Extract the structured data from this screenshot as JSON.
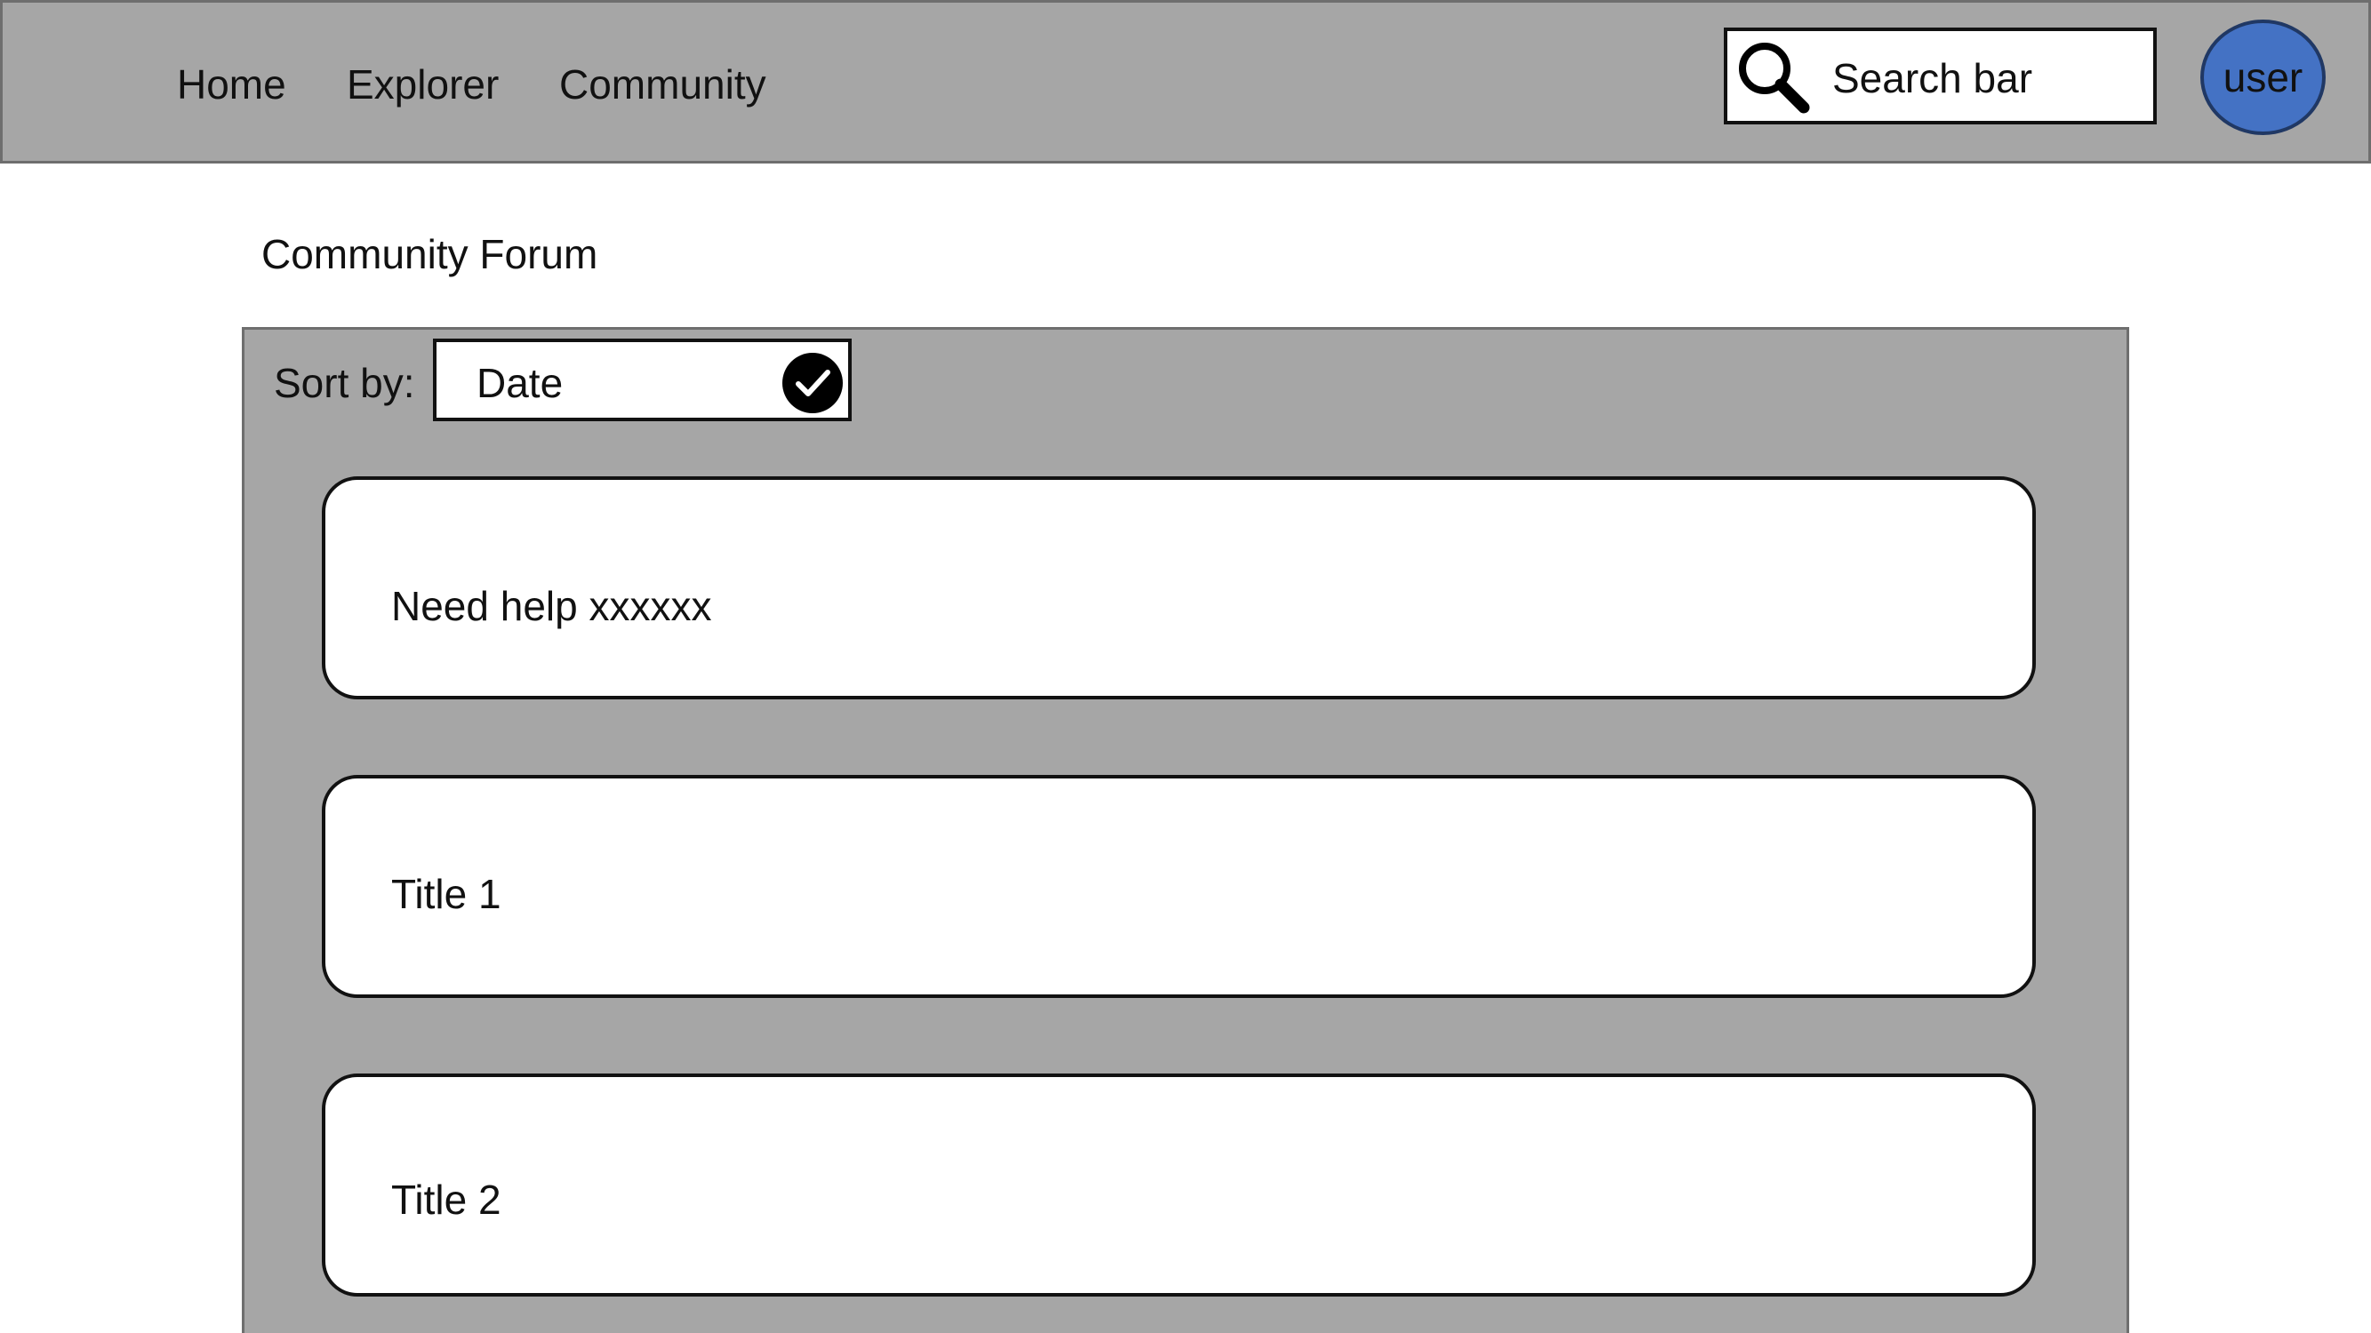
{
  "nav": {
    "items": [
      {
        "label": "Home"
      },
      {
        "label": "Explorer"
      },
      {
        "label": "Community"
      }
    ]
  },
  "search": {
    "label": "Search bar",
    "icon": "search-icon"
  },
  "user": {
    "label": "user",
    "avatar_color": "#4472c4"
  },
  "page": {
    "title": "Community Forum"
  },
  "sort": {
    "label": "Sort by:",
    "selected": "Date",
    "icon": "check-circle-icon"
  },
  "posts": [
    {
      "title": "Need help xxxxxx"
    },
    {
      "title": "Title 1"
    },
    {
      "title": "Title 2"
    }
  ],
  "colors": {
    "panel_background": "#a6a6a6",
    "card_background": "#ffffff"
  }
}
